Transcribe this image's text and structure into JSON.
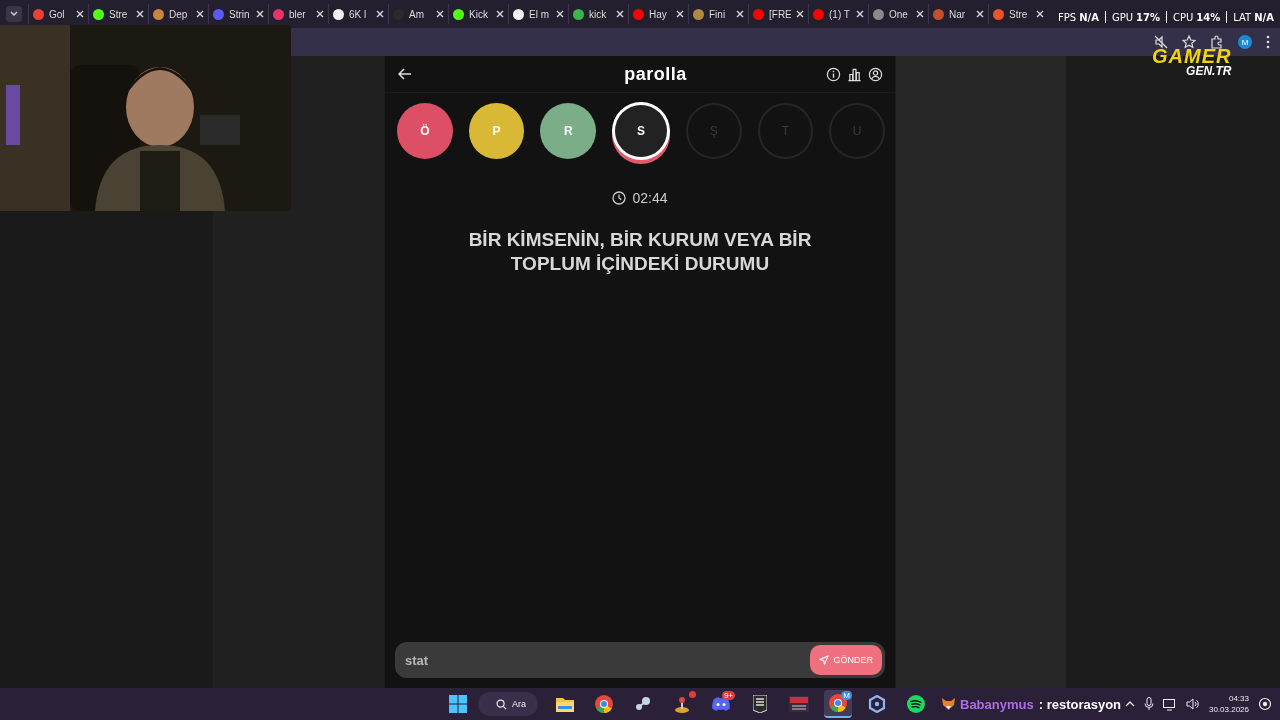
{
  "browser": {
    "tabs": [
      {
        "title": "Gol",
        "color": "#ea4335",
        "selected": false
      },
      {
        "title": "Stre",
        "color": "#53fc18",
        "selected": false
      },
      {
        "title": "Dep",
        "color": "#c9853a",
        "selected": false
      },
      {
        "title": "Strin",
        "color": "#5a5af0",
        "selected": false
      },
      {
        "title": "bler",
        "color": "#e8336b",
        "selected": false
      },
      {
        "title": "6K l",
        "color": "#f2f2f2",
        "selected": false
      },
      {
        "title": "Am",
        "color": "#2a2a2a",
        "selected": false
      },
      {
        "title": "Kick",
        "color": "#53fc18",
        "selected": false
      },
      {
        "title": "El m",
        "color": "#f2f2f2",
        "selected": false
      },
      {
        "title": "kick",
        "color": "#3bb54a",
        "selected": false
      },
      {
        "title": "Hay",
        "color": "#ff0000",
        "selected": false
      },
      {
        "title": "Fini",
        "color": "#b08a3a",
        "selected": false
      },
      {
        "title": "[FRE",
        "color": "#ff0000",
        "selected": false
      },
      {
        "title": "(1) T",
        "color": "#ff0000",
        "selected": false
      },
      {
        "title": "One",
        "color": "#8a8a8a",
        "selected": false
      },
      {
        "title": "Nar",
        "color": "#c0502a",
        "selected": false
      },
      {
        "title": "Stre",
        "color": "#e8552a",
        "selected": false
      }
    ],
    "avatar": "M"
  },
  "overlay": {
    "stats": [
      {
        "label": "FPS",
        "value": "N/A"
      },
      {
        "label": "GPU",
        "value": "17%"
      },
      {
        "label": "CPU",
        "value": "14%"
      },
      {
        "label": "LAT",
        "value": "N/A"
      }
    ],
    "logo": {
      "line_1": "GAMER",
      "line_2": "GEN.TR"
    }
  },
  "app": {
    "title": "parolla",
    "letters": [
      {
        "letter": "Ö",
        "kind": "wrong"
      },
      {
        "letter": "P",
        "kind": "passed"
      },
      {
        "letter": "R",
        "kind": "correct"
      },
      {
        "letter": "S",
        "kind": "current"
      },
      {
        "letter": "Ş",
        "kind": "pending"
      },
      {
        "letter": "T",
        "kind": "pending"
      },
      {
        "letter": "U",
        "kind": "pending"
      }
    ],
    "timer": "02:44",
    "question": "BİR KİMSENİN, BİR KURUM VEYA BİR TOPLUM İÇİNDEKİ DURUMU",
    "answer": {
      "value": "stat"
    },
    "submit": "GÖNDER"
  },
  "chat": {
    "user": "Babanymus",
    "message": ": restorasyon"
  },
  "taskbar": {
    "search": "Ara",
    "apps": [
      {
        "kind": "folder",
        "dot": false,
        "selected": false
      },
      {
        "kind": "chrome",
        "dot": false,
        "selected": false
      },
      {
        "kind": "steam",
        "dot": false,
        "selected": false
      },
      {
        "kind": "joystick",
        "dot": true,
        "selected": false
      },
      {
        "kind": "discord",
        "badge": "9+",
        "dot": false,
        "selected": false
      },
      {
        "kind": "epic",
        "dot": false,
        "selected": false
      },
      {
        "kind": "mixer",
        "dot": false,
        "selected": false
      },
      {
        "kind": "chrome",
        "badge": "M",
        "dot": false,
        "selected": true
      },
      {
        "kind": "cube",
        "dot": false,
        "selected": false
      },
      {
        "kind": "spotify",
        "dot": false,
        "selected": false
      }
    ],
    "clock": {
      "time": "04:33",
      "date": "30.03.2026"
    }
  }
}
